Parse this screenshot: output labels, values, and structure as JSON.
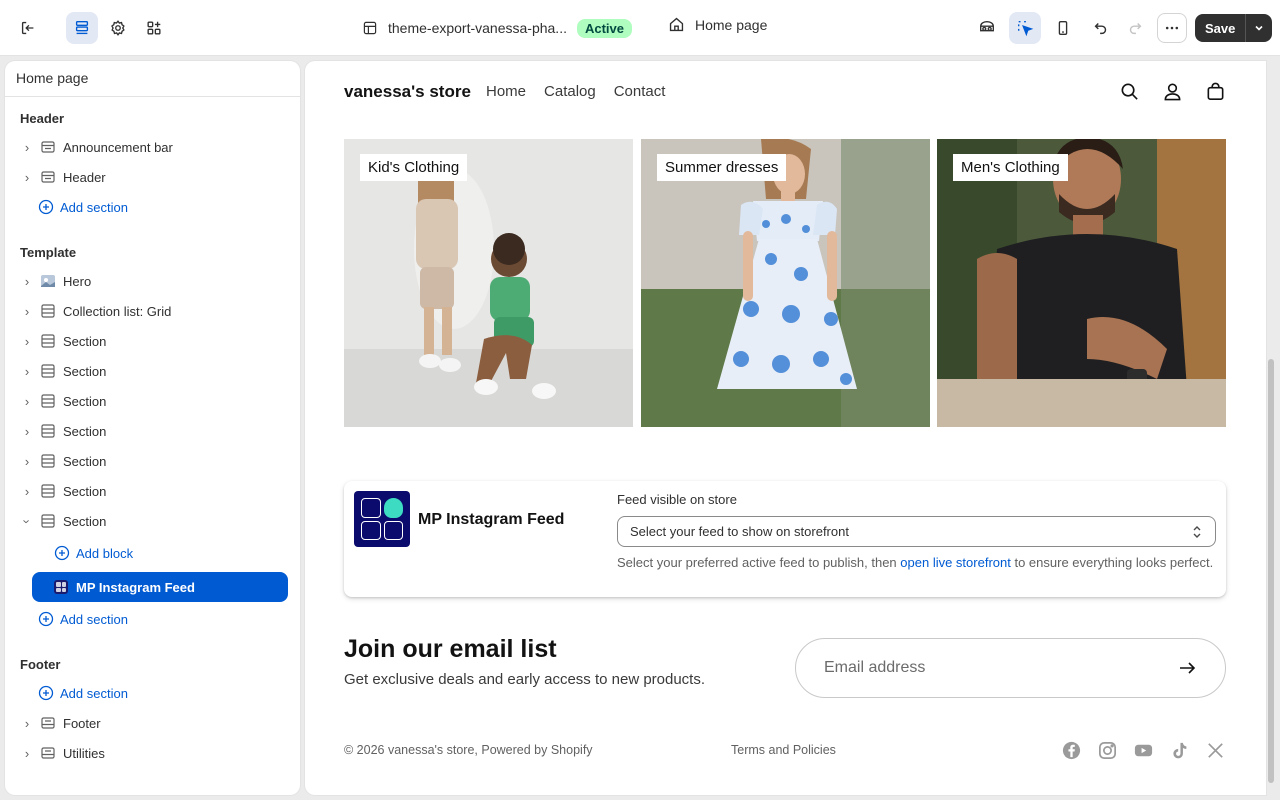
{
  "topbar": {
    "theme_name": "theme-export-vanessa-pha...",
    "status_badge": "Active",
    "page_name": "Home page",
    "save_label": "Save"
  },
  "sidebar": {
    "title": "Home page",
    "header_group": "Header",
    "header_items": [
      "Announcement bar",
      "Header"
    ],
    "add_section": "Add section",
    "template_group": "Template",
    "template_items": [
      "Hero",
      "Collection list: Grid",
      "Section",
      "Section",
      "Section",
      "Section",
      "Section",
      "Section",
      "Section"
    ],
    "add_block": "Add block",
    "selected_block": "MP Instagram Feed",
    "footer_group": "Footer",
    "footer_items": [
      "Footer",
      "Utilities"
    ]
  },
  "store": {
    "logo": "vanessa's store",
    "nav": [
      "Home",
      "Catalog",
      "Contact"
    ],
    "collections": [
      "Kid's Clothing",
      "Summer dresses",
      "Men's Clothing"
    ],
    "instagram": {
      "title": "MP Instagram Feed",
      "field_label": "Feed visible on store",
      "select_value": "Select your feed to show on storefront",
      "help_before": "Select your preferred active feed to publish, then ",
      "help_link": "open live storefront",
      "help_after": " to ensure everything looks perfect."
    },
    "newsletter": {
      "title": "Join our email list",
      "subtitle": "Get exclusive deals and early access to new products.",
      "email_placeholder": "Email address"
    },
    "footer": {
      "copyright": "© 2026 vanessa's store, Powered by Shopify",
      "terms": "Terms and Policies"
    }
  },
  "colors": {
    "accent": "#005bd3",
    "active_badge_bg": "#affebf",
    "save_bg": "#303030"
  }
}
